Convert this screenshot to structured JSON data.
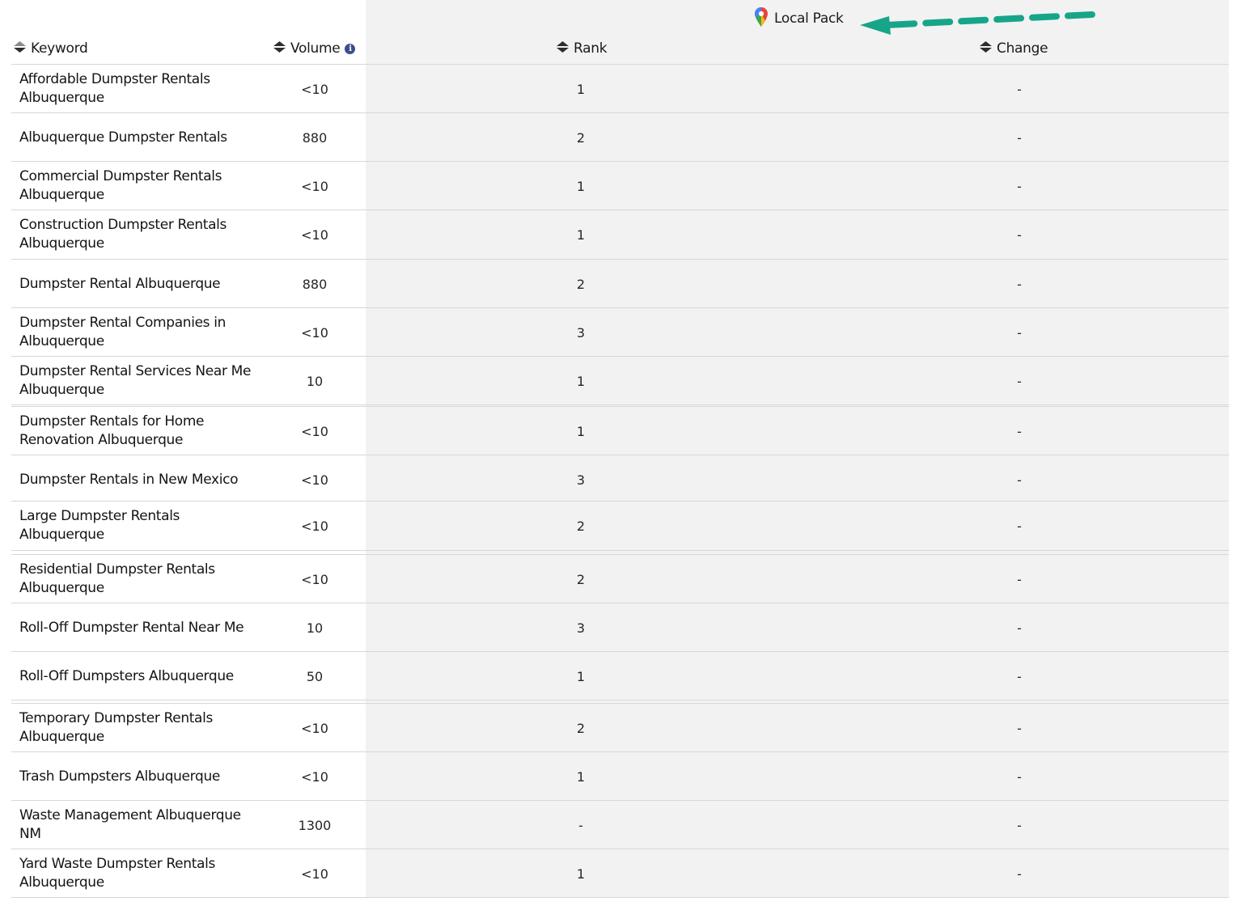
{
  "header": {
    "section_title": "Local Pack",
    "col_keyword": "Keyword",
    "col_volume": "Volume",
    "col_rank": "Rank",
    "col_change": "Change",
    "info_glyph": "i"
  },
  "icons": {
    "local_pack": "map-pin-icon",
    "sort": "sort-icon",
    "info": "info-icon",
    "annotation": "dashed-arrow-icon"
  },
  "colors": {
    "annotation_arrow": "#17a589",
    "info_icon": "#3c4c8e",
    "panel_bg": "#f2f2f2"
  },
  "rows": [
    {
      "keyword": "Affordable Dumpster Rentals Albuquerque",
      "volume": "<10",
      "rank": "1",
      "change": "-"
    },
    {
      "keyword": "Albuquerque Dumpster Rentals",
      "volume": "880",
      "rank": "2",
      "change": "-"
    },
    {
      "keyword": "Commercial Dumpster Rentals Albuquerque",
      "volume": "<10",
      "rank": "1",
      "change": "-"
    },
    {
      "keyword": "Construction Dumpster Rentals Albuquerque",
      "volume": "<10",
      "rank": "1",
      "change": "-"
    },
    {
      "keyword": "Dumpster Rental Albuquerque",
      "volume": "880",
      "rank": "2",
      "change": "-"
    },
    {
      "keyword": "Dumpster Rental Companies in Albuquerque",
      "volume": "<10",
      "rank": "3",
      "change": "-"
    },
    {
      "keyword": "Dumpster Rental Services Near Me Albuquerque",
      "volume": "10",
      "rank": "1",
      "change": "-"
    },
    {
      "keyword": "Dumpster Rentals for Home Renovation Albuquerque",
      "volume": "<10",
      "rank": "1",
      "change": "-"
    },
    {
      "keyword": "Dumpster Rentals in New Mexico",
      "volume": "<10",
      "rank": "3",
      "change": "-"
    },
    {
      "keyword": "Large Dumpster Rentals Albuquerque",
      "volume": "<10",
      "rank": "2",
      "change": "-"
    },
    {
      "keyword": "Residential Dumpster Rentals Albuquerque",
      "volume": "<10",
      "rank": "2",
      "change": "-"
    },
    {
      "keyword": "Roll-Off Dumpster Rental Near Me",
      "volume": "10",
      "rank": "3",
      "change": "-"
    },
    {
      "keyword": "Roll-Off Dumpsters Albuquerque",
      "volume": "50",
      "rank": "1",
      "change": "-"
    },
    {
      "keyword": "Temporary Dumpster Rentals Albuquerque",
      "volume": "<10",
      "rank": "2",
      "change": "-"
    },
    {
      "keyword": "Trash Dumpsters Albuquerque",
      "volume": "<10",
      "rank": "1",
      "change": "-"
    },
    {
      "keyword": "Waste Management Albuquerque NM",
      "volume": "1300",
      "rank": "-",
      "change": "-"
    },
    {
      "keyword": "Yard Waste Dumpster Rentals Albuquerque",
      "volume": "<10",
      "rank": "1",
      "change": "-"
    }
  ]
}
